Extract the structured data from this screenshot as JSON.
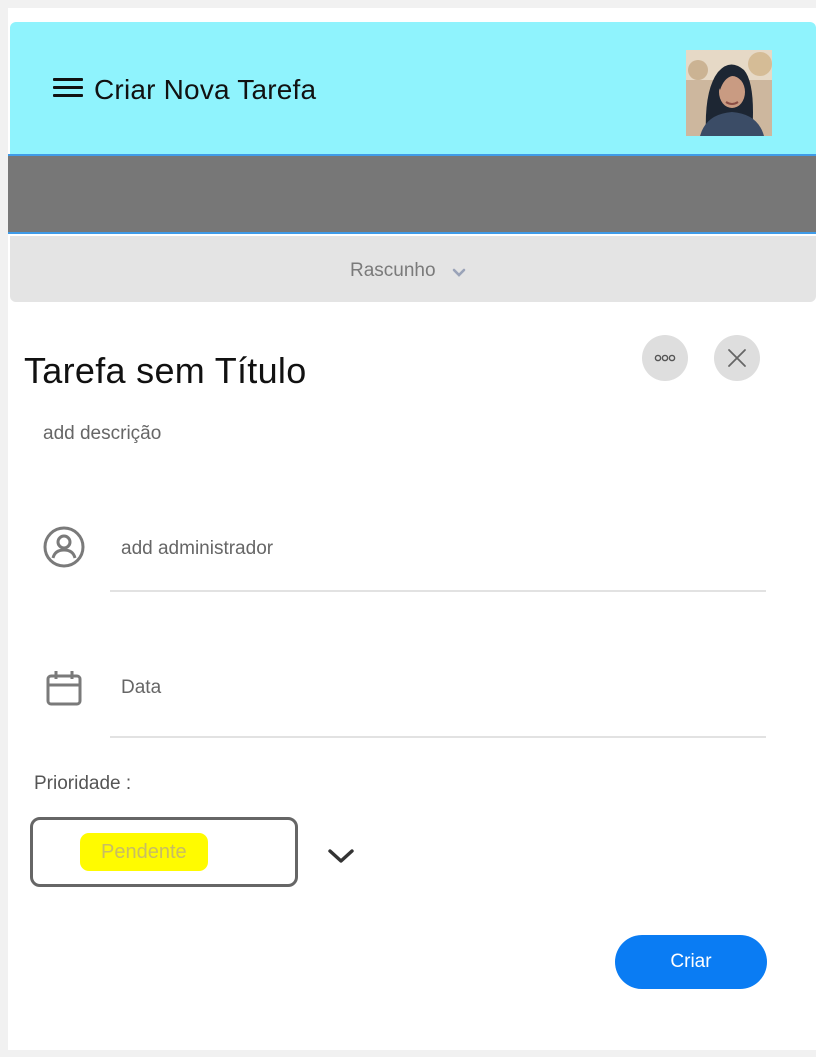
{
  "header": {
    "title": "Criar Nova Tarefa",
    "background": "#8ff3fd",
    "avatar_alt": "user-photo"
  },
  "status": {
    "selected": "Rascunho"
  },
  "task": {
    "title": "Tarefa sem Título",
    "description_placeholder": "add descrição"
  },
  "fields": {
    "admin_placeholder": "add administrador",
    "date_placeholder": "Data"
  },
  "priority": {
    "label": "Prioridade :",
    "selected": "Pendente",
    "pill_color": "#fffb00"
  },
  "actions": {
    "create_label": "Criar",
    "create_color": "#0a7cf3"
  },
  "icons": [
    "menu-icon",
    "chevron-down-icon",
    "more-options-icon",
    "close-icon",
    "user-circle-icon",
    "calendar-icon"
  ]
}
